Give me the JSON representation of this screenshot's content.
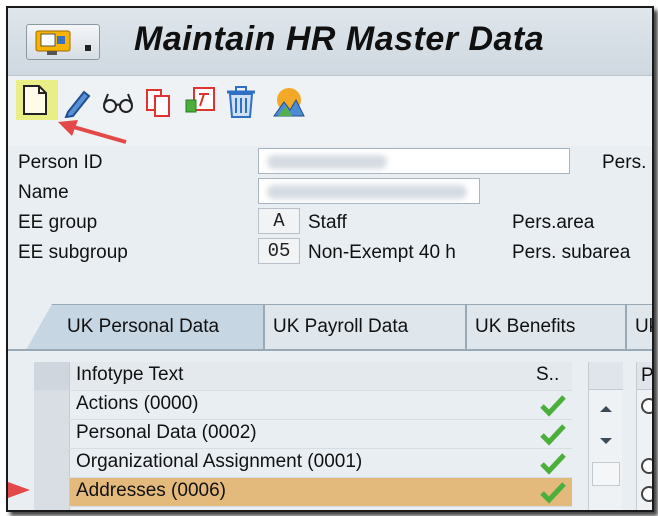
{
  "window": {
    "title": "Maintain HR Master Data"
  },
  "colors": {
    "selected_row": "#e3ba7c",
    "create_highlight": "#e9ef86",
    "arrow": "#e34949",
    "check": "#4caf3b"
  },
  "toolbar": {
    "icons": [
      "create-icon",
      "change-icon",
      "display-icon",
      "copy-icon",
      "delimit-icon",
      "delete-icon",
      "overview-icon"
    ]
  },
  "header": {
    "person_id_label": "Person ID",
    "pers_label": "Pers.",
    "name_label": "Name",
    "ee_group_label": "EE group",
    "ee_group_code": "A",
    "ee_group_text": "Staff",
    "pers_area_label": "Pers.area",
    "ee_subgroup_label": "EE subgroup",
    "ee_subgroup_code": "05",
    "ee_subgroup_text": "Non-Exempt 40 h",
    "pers_subarea_label": "Pers. subarea"
  },
  "tabs": [
    "UK Personal Data",
    "UK Payroll Data",
    "UK Benefits",
    "Uk"
  ],
  "table": {
    "col_text": "Infotype Text",
    "col_status": "S..",
    "rows": [
      {
        "text": "Actions (0000)"
      },
      {
        "text": "Personal Data (0002)"
      },
      {
        "text": "Organizational Assignment (0001)"
      },
      {
        "text": "Addresses (0006)"
      }
    ]
  },
  "right_panel": {
    "header": "P"
  }
}
